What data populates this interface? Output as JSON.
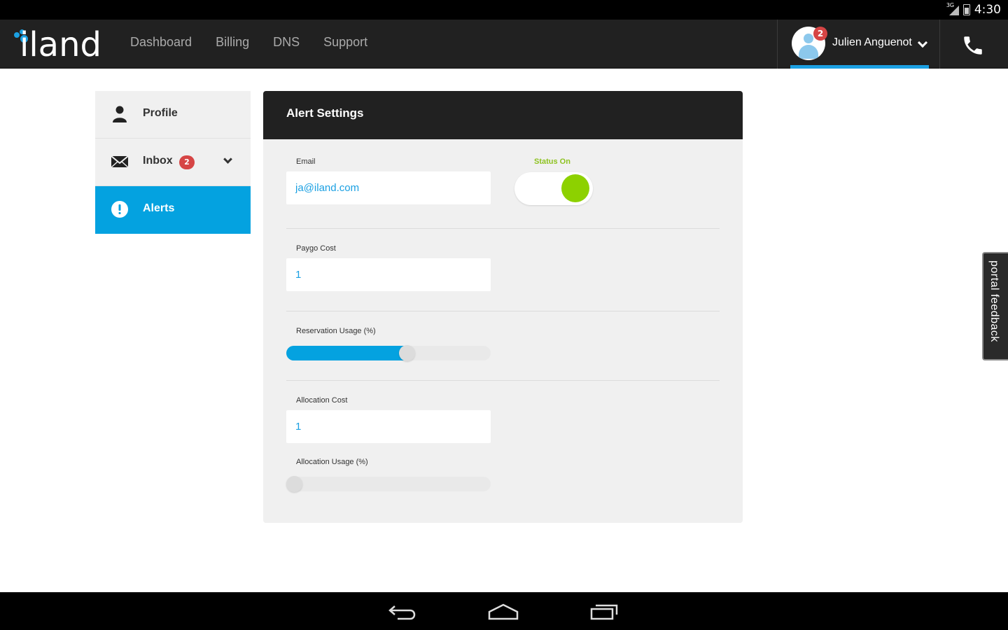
{
  "status_bar": {
    "network": "3G",
    "time": "4:30"
  },
  "topnav": {
    "logo_text": "iland",
    "links": [
      "Dashboard",
      "Billing",
      "DNS",
      "Support"
    ],
    "user": {
      "name": "Julien Anguenot",
      "notifications": "2"
    }
  },
  "sidebar": {
    "items": [
      {
        "label": "Profile",
        "icon": "person-icon"
      },
      {
        "label": "Inbox",
        "icon": "envelope-icon",
        "badge": "2"
      },
      {
        "label": "Alerts",
        "icon": "alert-icon",
        "active": true
      }
    ]
  },
  "panel": {
    "title": "Alert Settings",
    "email": {
      "label": "Email",
      "value": "ja@iland.com"
    },
    "status": {
      "label": "Status On",
      "on": true
    },
    "paygo": {
      "label": "Paygo Cost",
      "value": "1"
    },
    "reservation": {
      "label": "Reservation Usage (%)",
      "level": 0.59
    },
    "allocation_cost": {
      "label": "Allocation Cost",
      "value": "1"
    },
    "allocation_usage": {
      "label": "Allocation Usage (%)",
      "level": 0.0
    }
  },
  "feedback": {
    "label": "portal feedback"
  },
  "colors": {
    "accent": "#04a2e0",
    "toggle_on": "#8dd100",
    "badge": "#d64545",
    "header": "#212121"
  }
}
